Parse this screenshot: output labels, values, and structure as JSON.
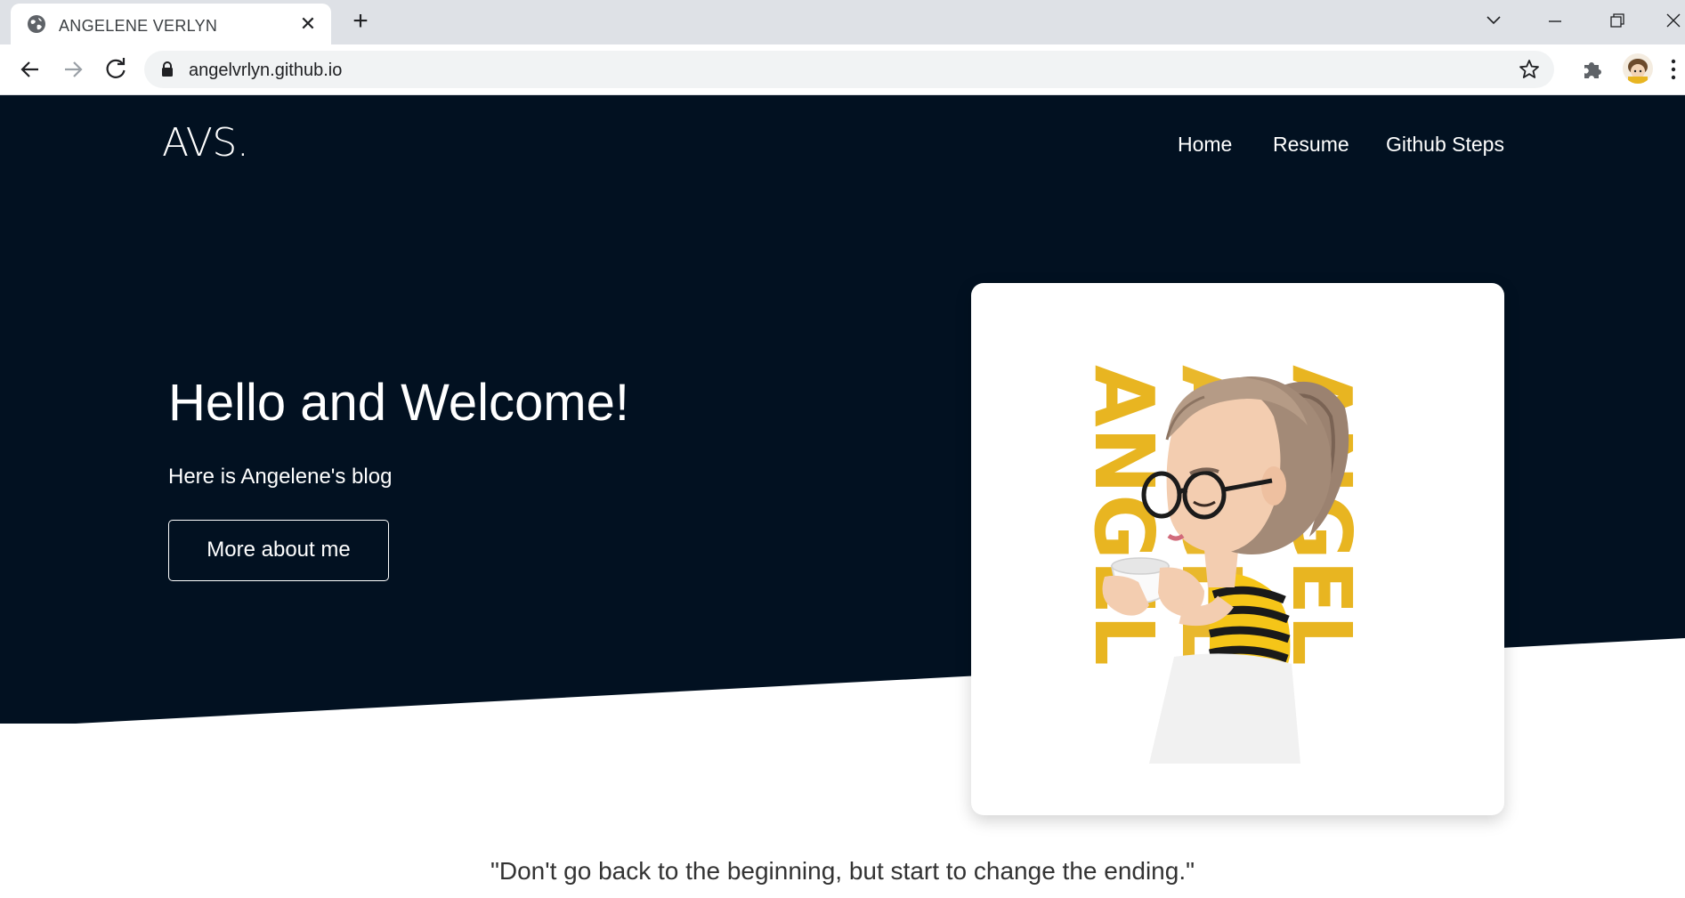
{
  "browser": {
    "tab_title": "ANGELENE VERLYN",
    "url": "angelvrlyn.github.io"
  },
  "site": {
    "brand": "AVS.",
    "nav": [
      "Home",
      "Resume",
      "Github Steps"
    ],
    "hero": {
      "title": "Hello and Welcome!",
      "subtitle": "Here is Angelene's blog",
      "button": "More about me"
    },
    "card_image_text": "ANGEL",
    "quote": "\"Don't go back to the beginning, but start to change the ending.\""
  },
  "colors": {
    "hero_bg": "#021121",
    "accent_yellow": "#e8b521",
    "text_white": "#ffffff"
  },
  "icons": {
    "tab": "globe-icon",
    "close": "close-icon",
    "new_tab": "plus-icon",
    "back": "back-arrow-icon",
    "forward": "forward-arrow-icon",
    "reload": "reload-icon",
    "lock": "lock-icon",
    "bookmark": "star-icon",
    "extensions": "puzzle-icon",
    "menu": "more-vertical-icon"
  }
}
